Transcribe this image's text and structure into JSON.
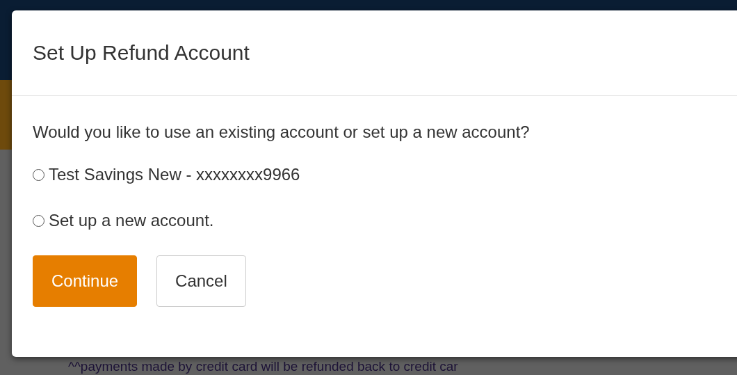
{
  "page": {
    "note": "^^payments made by credit card will be refunded back to credit car"
  },
  "modal": {
    "title": "Set Up Refund Account",
    "question": "Would you like to use an existing account or set up a new account?",
    "options": [
      {
        "label": "Test Savings New - xxxxxxxx9966",
        "selected": false
      },
      {
        "label": "Set up a new account.",
        "selected": false
      }
    ],
    "buttons": [
      {
        "label": "Continue",
        "kind": "primary"
      },
      {
        "label": "Cancel",
        "kind": "secondary"
      }
    ]
  }
}
